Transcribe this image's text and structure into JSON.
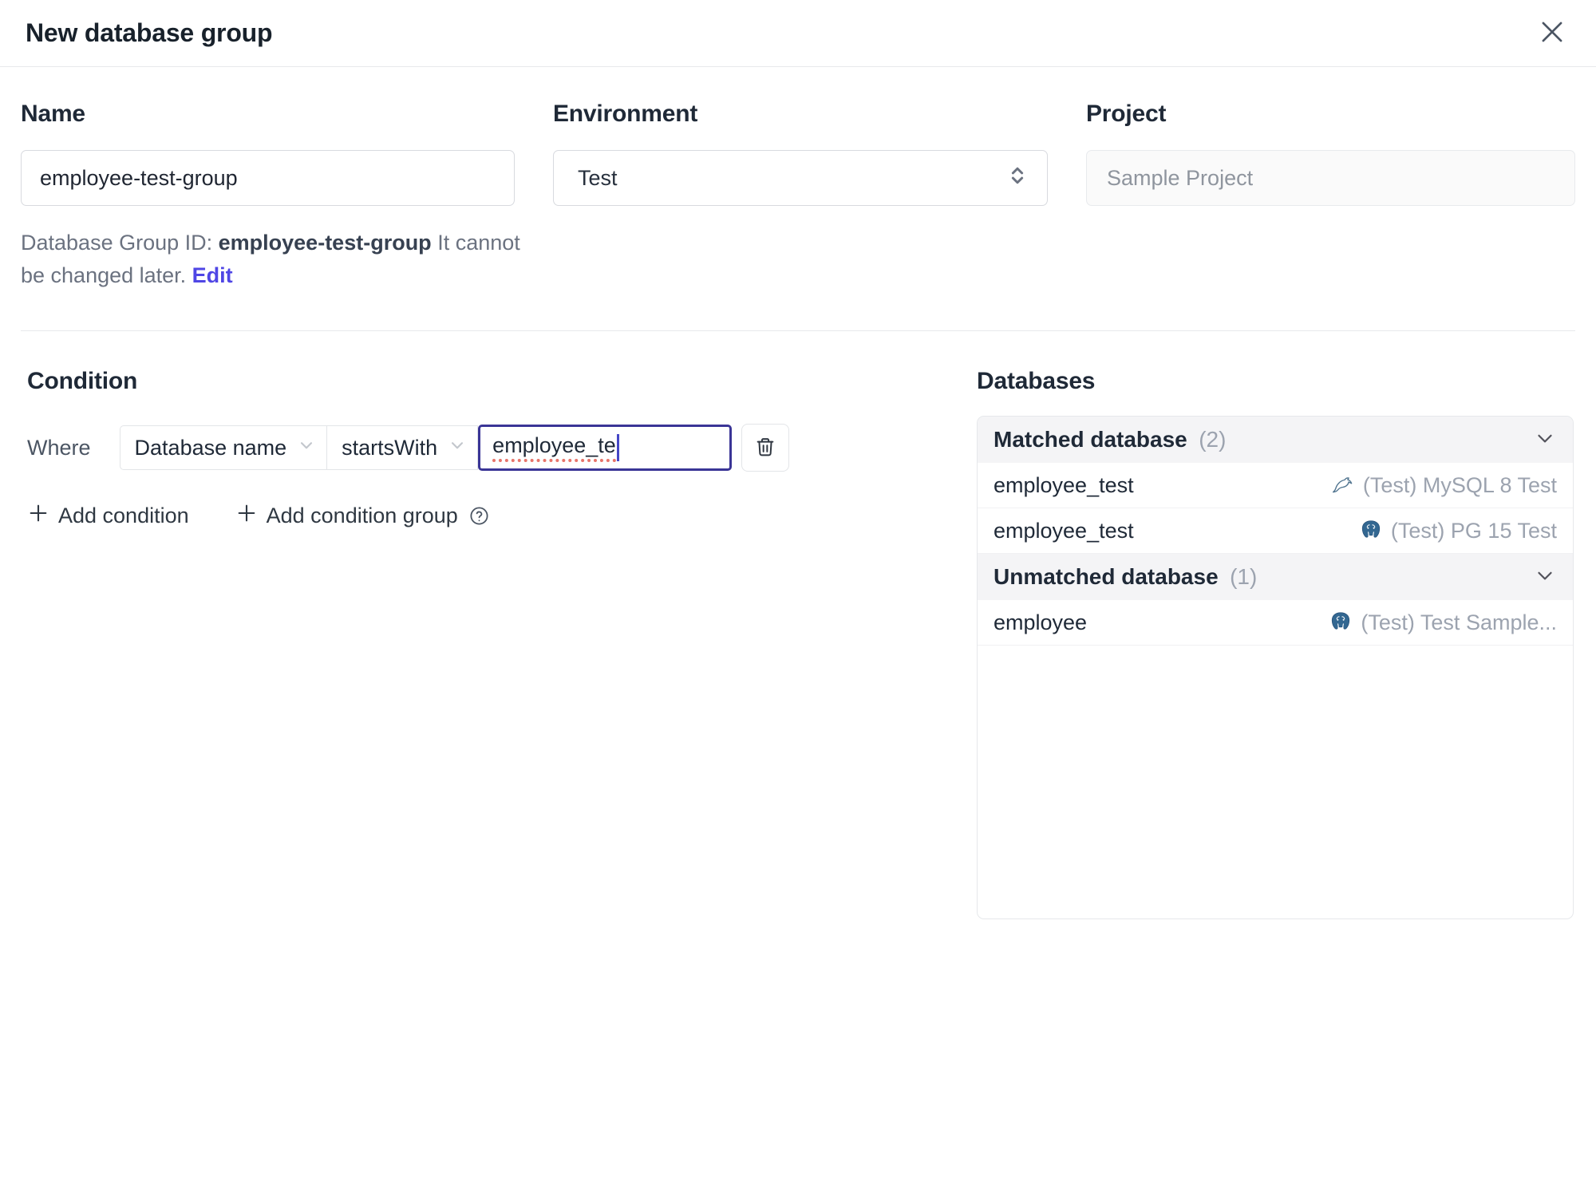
{
  "header": {
    "title": "New database group"
  },
  "form": {
    "name": {
      "label": "Name",
      "value": "employee-test-group"
    },
    "environment": {
      "label": "Environment",
      "value": "Test"
    },
    "project": {
      "label": "Project",
      "value": "Sample Project"
    },
    "group_id_note": {
      "prefix": "Database Group ID: ",
      "id": "employee-test-group",
      "suffix": " It cannot be changed later. ",
      "edit_label": "Edit"
    }
  },
  "condition": {
    "title": "Condition",
    "where_label": "Where",
    "field_selected": "Database name",
    "operator_selected": "startsWith",
    "value": "employee_te",
    "add_condition_label": "Add condition",
    "add_condition_group_label": "Add condition group"
  },
  "databases": {
    "title": "Databases",
    "matched": {
      "label": "Matched database",
      "count": "(2)",
      "rows": [
        {
          "name": "employee_test",
          "engine": "mysql",
          "instance": "(Test) MySQL 8 Test"
        },
        {
          "name": "employee_test",
          "engine": "postgres",
          "instance": "(Test) PG 15 Test"
        }
      ]
    },
    "unmatched": {
      "label": "Unmatched database",
      "count": "(1)",
      "rows": [
        {
          "name": "employee",
          "engine": "postgres",
          "instance": "(Test) Test Sample..."
        }
      ]
    }
  },
  "colors": {
    "accent_link": "#4f46e5",
    "focus_border": "#3a3596",
    "spellcheck_underline": "#e8756b",
    "muted_text": "#9ca3af",
    "section_header_bg": "#f4f4f6",
    "mysql_icon": "#50748f",
    "postgres_icon": "#336791"
  }
}
